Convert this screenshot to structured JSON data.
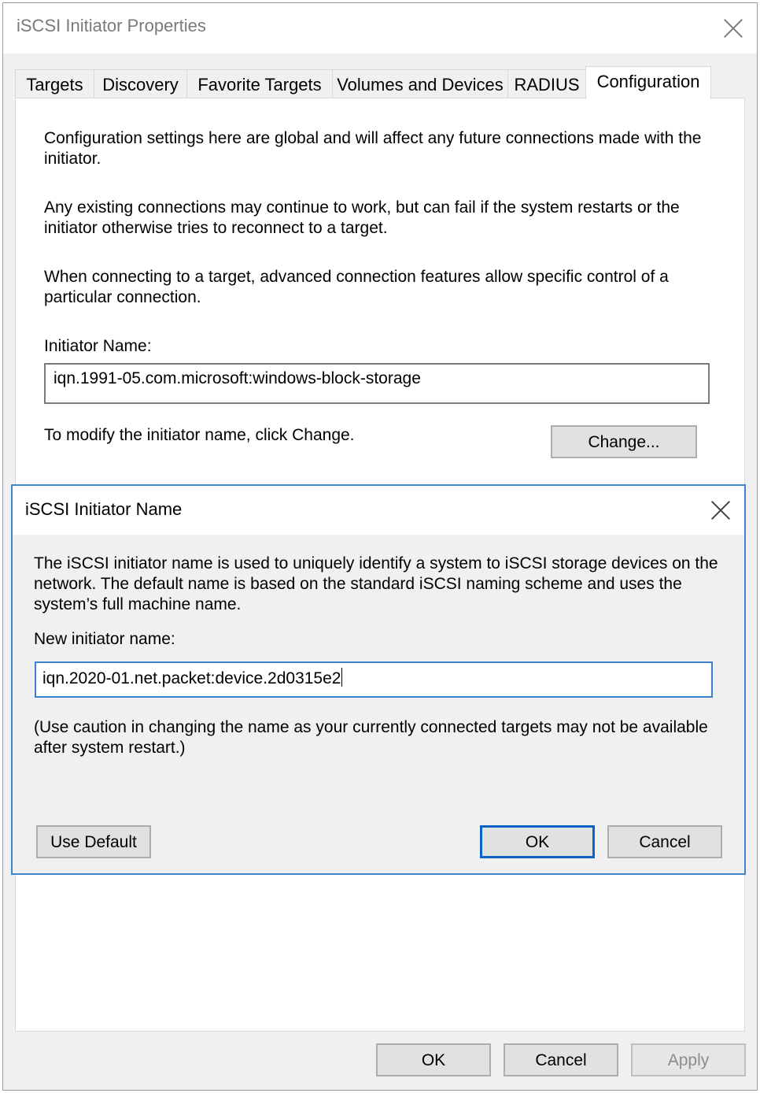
{
  "window": {
    "title": "iSCSI Initiator Properties"
  },
  "tabs": [
    {
      "label": "Targets"
    },
    {
      "label": "Discovery"
    },
    {
      "label": "Favorite Targets"
    },
    {
      "label": "Volumes and Devices"
    },
    {
      "label": "RADIUS"
    },
    {
      "label": "Configuration"
    }
  ],
  "active_tab": "Configuration",
  "configuration": {
    "para1": "Configuration settings here are global and will affect any future connections made with the initiator.",
    "para2": "Any existing connections may continue to work, but can fail if the system restarts or the initiator otherwise tries to reconnect to a target.",
    "para3": "When connecting to a target, advanced connection features allow specific control of a particular connection.",
    "initiator_name_label": "Initiator Name:",
    "initiator_name_value": "iqn.1991-05.com.microsoft:windows-block-storage",
    "modify_hint": "To modify the initiator name, click Change.",
    "change_button": "Change..."
  },
  "footer": {
    "ok": "OK",
    "cancel": "Cancel",
    "apply": "Apply"
  },
  "dialog": {
    "title": "iSCSI Initiator Name",
    "description": "The iSCSI initiator name is used to uniquely identify a system to iSCSI storage devices on the network.  The default name is based on the standard iSCSI naming scheme and uses the system’s full machine name.",
    "new_name_label": "New initiator name:",
    "new_name_value": "iqn.2020-01.net.packet:device.2d0315e2",
    "caution": "(Use caution in changing the name as your currently connected targets may not be available after system restart.)",
    "use_default_button": "Use Default",
    "ok_button": "OK",
    "cancel_button": "Cancel"
  }
}
